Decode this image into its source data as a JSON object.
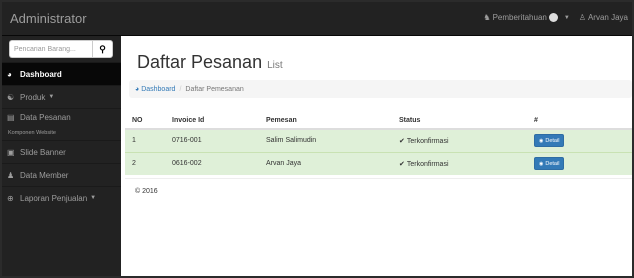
{
  "brand": "Administrator",
  "navbar": {
    "notifications_label": "Pemberitahuan",
    "user_label": "Arvan Jaya"
  },
  "sidebar": {
    "search_placeholder": "Pencarian Barang...",
    "items": [
      {
        "label": "Dashboard",
        "icon": "dashboard-icon",
        "active": true
      },
      {
        "label": "Produk",
        "icon": "shapes-icon",
        "has_caret": true
      },
      {
        "label": "Data Pesanan",
        "icon": "list-icon"
      },
      {
        "label": "Komponen Website"
      },
      {
        "label": "Slide Banner",
        "icon": "image-icon"
      },
      {
        "label": "Data Member",
        "icon": "users-icon"
      },
      {
        "label": "Laporan Penjualan",
        "icon": "globe-icon",
        "has_caret": true
      }
    ]
  },
  "page": {
    "title": "Daftar Pesanan",
    "subtitle": "List",
    "breadcrumb": {
      "home": "Dashboard",
      "current": "Daftar Pemesanan"
    }
  },
  "table": {
    "headers": [
      "NO",
      "Invoice Id",
      "Pemesan",
      "Status",
      "#"
    ],
    "rows": [
      {
        "no": "1",
        "invoice": "0716-001",
        "pemesan": "Salim Salimudin",
        "status": "Terkonfirmasi",
        "action": "Detail"
      },
      {
        "no": "2",
        "invoice": "0616-002",
        "pemesan": "Arvan Jaya",
        "status": "Terkonfirmasi",
        "action": "Detail"
      }
    ]
  },
  "footer": "© 2016",
  "colors": {
    "navbar": "#222222",
    "row_success": "#dff0d8",
    "primary": "#337ab7"
  }
}
